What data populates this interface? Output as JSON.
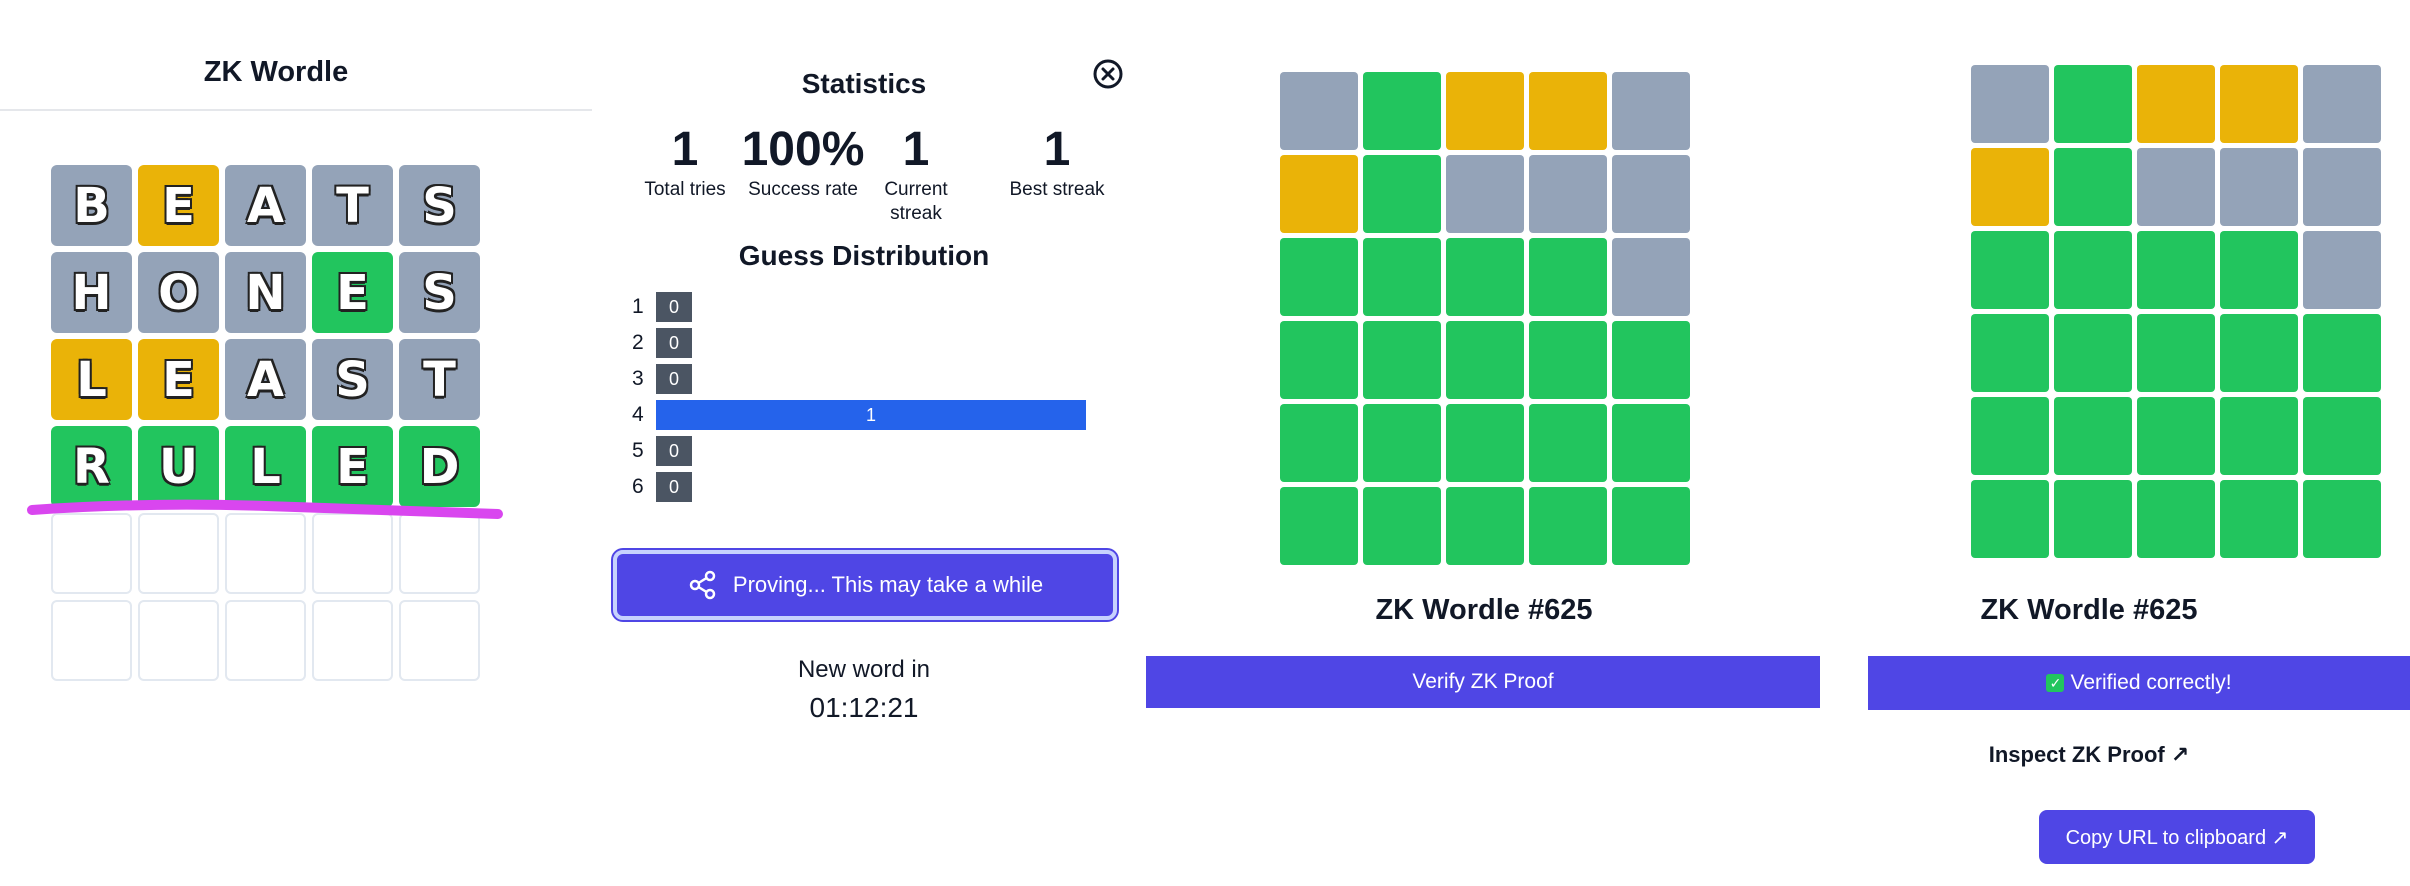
{
  "game": {
    "title": "ZK Wordle",
    "rows": [
      [
        {
          "l": "B",
          "s": "gray"
        },
        {
          "l": "E",
          "s": "yellow"
        },
        {
          "l": "A",
          "s": "gray"
        },
        {
          "l": "T",
          "s": "gray"
        },
        {
          "l": "S",
          "s": "gray"
        }
      ],
      [
        {
          "l": "H",
          "s": "gray"
        },
        {
          "l": "O",
          "s": "gray"
        },
        {
          "l": "N",
          "s": "gray"
        },
        {
          "l": "E",
          "s": "green"
        },
        {
          "l": "S",
          "s": "gray"
        }
      ],
      [
        {
          "l": "L",
          "s": "yellow"
        },
        {
          "l": "E",
          "s": "yellow"
        },
        {
          "l": "A",
          "s": "gray"
        },
        {
          "l": "S",
          "s": "gray"
        },
        {
          "l": "T",
          "s": "gray"
        }
      ],
      [
        {
          "l": "R",
          "s": "green"
        },
        {
          "l": "U",
          "s": "green"
        },
        {
          "l": "L",
          "s": "green"
        },
        {
          "l": "E",
          "s": "green"
        },
        {
          "l": "D",
          "s": "green"
        }
      ],
      [
        {
          "l": "",
          "s": "empty"
        },
        {
          "l": "",
          "s": "empty"
        },
        {
          "l": "",
          "s": "empty"
        },
        {
          "l": "",
          "s": "empty"
        },
        {
          "l": "",
          "s": "empty"
        }
      ],
      [
        {
          "l": "",
          "s": "empty"
        },
        {
          "l": "",
          "s": "empty"
        },
        {
          "l": "",
          "s": "empty"
        },
        {
          "l": "",
          "s": "empty"
        },
        {
          "l": "",
          "s": "empty"
        }
      ]
    ],
    "annotation_color": "#d946ef"
  },
  "stats": {
    "title": "Statistics",
    "items": [
      {
        "value": "1",
        "label": "Total tries"
      },
      {
        "value": "100%",
        "label": "Success rate"
      },
      {
        "value": "1",
        "label": "Current streak"
      },
      {
        "value": "1",
        "label": "Best streak"
      }
    ],
    "distribution_title": "Guess Distribution",
    "distribution": [
      {
        "guess": "1",
        "count": 0,
        "label": "0",
        "current": false
      },
      {
        "guess": "2",
        "count": 0,
        "label": "0",
        "current": false
      },
      {
        "guess": "3",
        "count": 0,
        "label": "0",
        "current": false
      },
      {
        "guess": "4",
        "count": 1,
        "label": "1",
        "current": true
      },
      {
        "guess": "5",
        "count": 0,
        "label": "0",
        "current": false
      },
      {
        "guess": "6",
        "count": 0,
        "label": "0",
        "current": false
      }
    ],
    "proving_label": "Proving... This may take a while",
    "new_word_label": "New word in",
    "countdown": "01:12:21",
    "close_icon": "close-circle-icon",
    "share_icon": "share-icon"
  },
  "share": {
    "grid": [
      [
        "gray",
        "green",
        "yellow",
        "yellow",
        "gray"
      ],
      [
        "yellow",
        "green",
        "gray",
        "gray",
        "gray"
      ],
      [
        "green",
        "green",
        "green",
        "green",
        "gray"
      ],
      [
        "green",
        "green",
        "green",
        "green",
        "green"
      ],
      [
        "green",
        "green",
        "green",
        "green",
        "green"
      ],
      [
        "green",
        "green",
        "green",
        "green",
        "green"
      ]
    ],
    "title": "ZK Wordle #625",
    "verify_label": "Verify ZK Proof"
  },
  "verified": {
    "grid": [
      [
        "gray",
        "green",
        "yellow",
        "yellow",
        "gray"
      ],
      [
        "yellow",
        "green",
        "gray",
        "gray",
        "gray"
      ],
      [
        "green",
        "green",
        "green",
        "green",
        "gray"
      ],
      [
        "green",
        "green",
        "green",
        "green",
        "green"
      ],
      [
        "green",
        "green",
        "green",
        "green",
        "green"
      ],
      [
        "green",
        "green",
        "green",
        "green",
        "green"
      ]
    ],
    "title": "ZK Wordle #625",
    "verified_label": "Verified correctly!",
    "inspect_label": "Inspect ZK Proof ↗",
    "copy_label": "Copy URL to clipboard ↗"
  },
  "colors": {
    "green": "#22c55e",
    "yellow": "#eab308",
    "gray": "#94a3b8",
    "accent": "#4f46e5",
    "current_bar": "#2563eb",
    "bar": "#4b5563"
  }
}
